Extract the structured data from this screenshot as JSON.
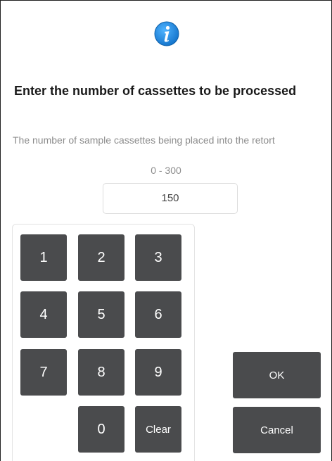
{
  "dialog": {
    "icon": "info-icon",
    "title": "Enter the number of cassettes to be processed",
    "description": "The number of sample cassettes being placed into the retort",
    "range": "0 - 300",
    "value": "150"
  },
  "keypad": {
    "keys": [
      "1",
      "2",
      "3",
      "4",
      "5",
      "6",
      "7",
      "8",
      "9",
      "0",
      "Clear"
    ]
  },
  "actions": {
    "ok_label": "OK",
    "cancel_label": "Cancel"
  },
  "colors": {
    "key_background": "#4a4b4d",
    "info_icon": "#1e8fe0"
  }
}
